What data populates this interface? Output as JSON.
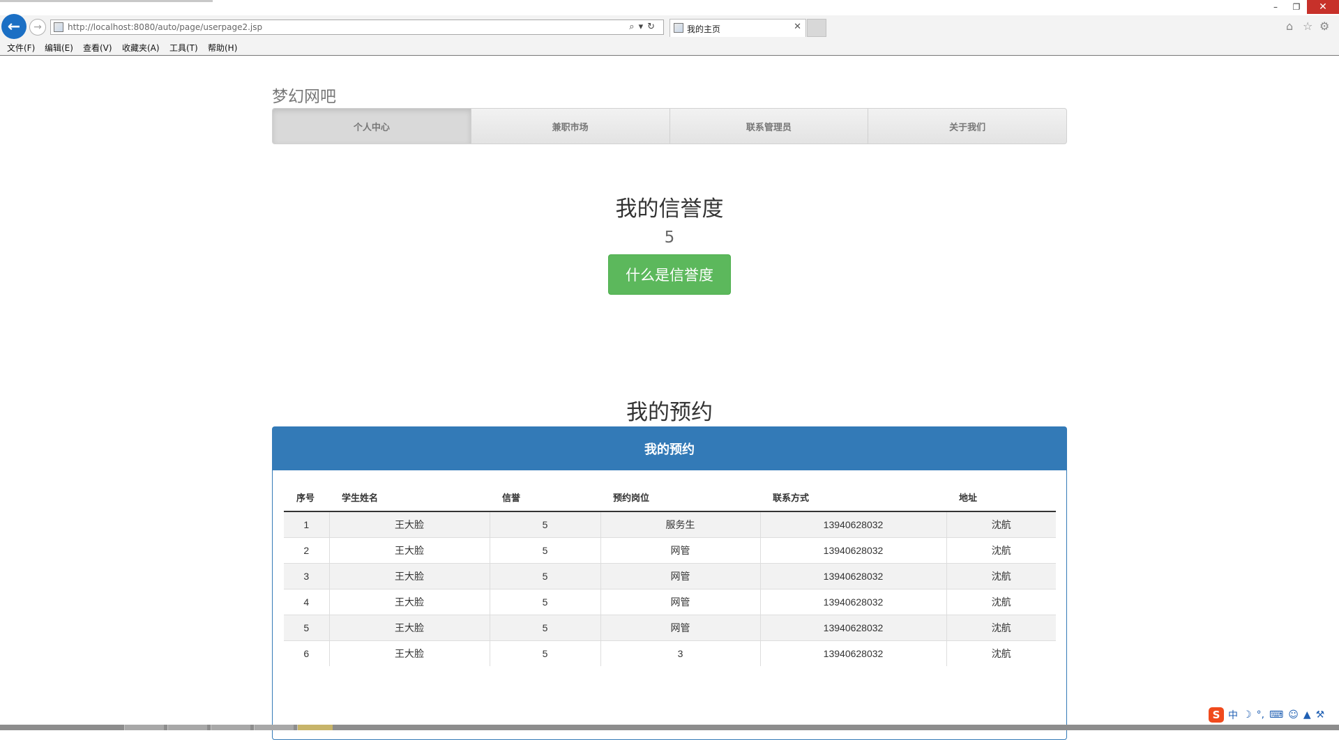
{
  "browser": {
    "url": "http://localhost:8080/auto/page/userpage2.jsp",
    "tab_title": "我的主页",
    "menu": [
      "文件(F)",
      "编辑(E)",
      "查看(V)",
      "收藏夹(A)",
      "工具(T)",
      "帮助(H)"
    ],
    "icons": {
      "back": "back-arrow-icon",
      "forward": "forward-arrow-icon",
      "search": "search-icon",
      "refresh": "refresh-icon",
      "home": "home-icon",
      "favorites": "star-icon",
      "settings": "gear-icon"
    }
  },
  "page": {
    "brand": "梦幻网吧",
    "nav": [
      {
        "label": "个人中心",
        "active": true
      },
      {
        "label": "兼职市场",
        "active": false
      },
      {
        "label": "联系管理员",
        "active": false
      },
      {
        "label": "关于我们",
        "active": false
      }
    ],
    "credit": {
      "title": "我的信誉度",
      "value": "5",
      "button_label": "什么是信誉度"
    },
    "reservations": {
      "section_title": "我的预约",
      "panel_title": "我的预约",
      "columns": [
        "序号",
        "学生姓名",
        "信誉",
        "预约岗位",
        "联系方式",
        "地址"
      ],
      "rows": [
        [
          "1",
          "王大脸",
          "5",
          "服务生",
          "13940628032",
          "沈航"
        ],
        [
          "2",
          "王大脸",
          "5",
          "网管",
          "13940628032",
          "沈航"
        ],
        [
          "3",
          "王大脸",
          "5",
          "网管",
          "13940628032",
          "沈航"
        ],
        [
          "4",
          "王大脸",
          "5",
          "网管",
          "13940628032",
          "沈航"
        ],
        [
          "5",
          "王大脸",
          "5",
          "网管",
          "13940628032",
          "沈航"
        ],
        [
          "6",
          "王大脸",
          "5",
          "3",
          "13940628032",
          "沈航"
        ]
      ]
    }
  },
  "colors": {
    "primary": "#337ab7",
    "success": "#5cb85c",
    "navbar_bg": "#e7e7e7"
  },
  "ime": {
    "mode": "中"
  }
}
